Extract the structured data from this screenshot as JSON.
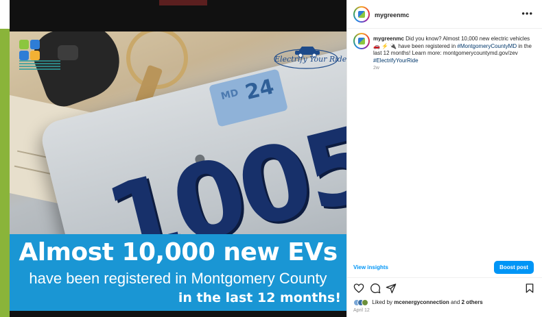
{
  "post_image": {
    "headline": "Almost 10,000 new EVs",
    "subline": "have been registered in Montgomery County",
    "tail": "in the last 12 months!",
    "plate_digits": "1005",
    "sticker_number": "24",
    "sticker_small": "MD",
    "campaign_logo_text": "Electrify Your Ride",
    "colors": {
      "caption_band": "#1a96d4",
      "green_strip": "#8ab43a",
      "plate_digits": "#17306a"
    }
  },
  "panel": {
    "header_username": "mygreenmc",
    "more_icon": "more-horizontal-icon",
    "caption": {
      "username": "mygreenmc",
      "text_part1": "Did you know? Almost 10,000 new electric vehicles",
      "emojis": "🚗 ⚡ 🔌",
      "text_part2": "have been registered in",
      "hashtag1": "#MontgomeryCountyMD",
      "text_part3": "in the last 12 months! Learn more: montgomerycountymd.gov/zev",
      "hashtag2": "#ElectrifyYourRide"
    },
    "caption_time": "2w",
    "view_insights": "View insights",
    "boost_button": "Boost post",
    "actions": [
      "heart-icon",
      "comment-icon",
      "share-icon",
      "bookmark-icon"
    ],
    "liked_by_prefix": "Liked by",
    "liked_by_user": "mcenergyconnection",
    "liked_by_mid": "and",
    "liked_by_others": "2 others",
    "post_date": "April 12",
    "accent_color": "#0095f6"
  }
}
